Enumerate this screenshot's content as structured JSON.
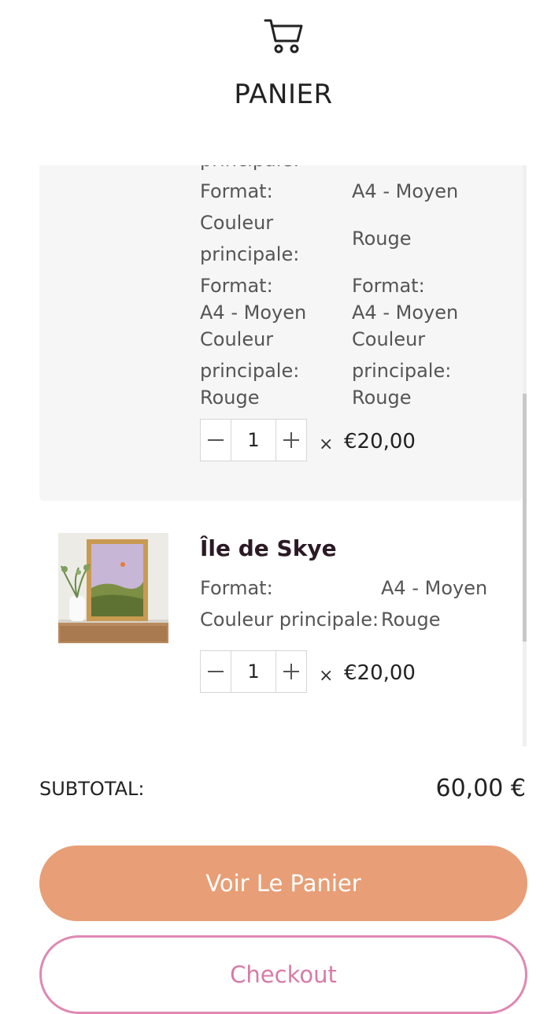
{
  "header": {
    "title": "PANIER",
    "icon": "cart-icon"
  },
  "items": [
    {
      "partial_top_label": "principale:",
      "attrs": [
        {
          "label": "Format:",
          "value": "A4 - Moyen"
        },
        {
          "label_line1": "Couleur",
          "label_line2": "principale:",
          "value": "Rouge"
        }
      ],
      "variant_blocks": [
        {
          "line1": "Format:",
          "line2": "A4 - Moyen",
          "line3": "Couleur",
          "line4": "principale:",
          "line5": "Rouge"
        },
        {
          "line1": "Format:",
          "line2": "A4 - Moyen",
          "line3": "Couleur",
          "line4": "principale:",
          "line5": "Rouge"
        }
      ],
      "quantity": "1",
      "times": "×",
      "price": "€20,00"
    },
    {
      "name": "Île de Skye",
      "attrs": [
        {
          "label": "Format:",
          "value": "A4 - Moyen"
        },
        {
          "label": "Couleur principale:",
          "value": "Rouge"
        }
      ],
      "quantity": "1",
      "times": "×",
      "price": "€20,00"
    }
  ],
  "summary": {
    "subtotal_label": "SUBTOTAL:",
    "subtotal_value": "60,00 €"
  },
  "actions": {
    "view_cart": "Voir Le Panier",
    "checkout": "Checkout"
  },
  "colors": {
    "view_cart_bg": "#e89e76",
    "checkout_border": "#df88b3",
    "checkout_text": "#d87aa8",
    "item_name": "#2b1a24"
  }
}
